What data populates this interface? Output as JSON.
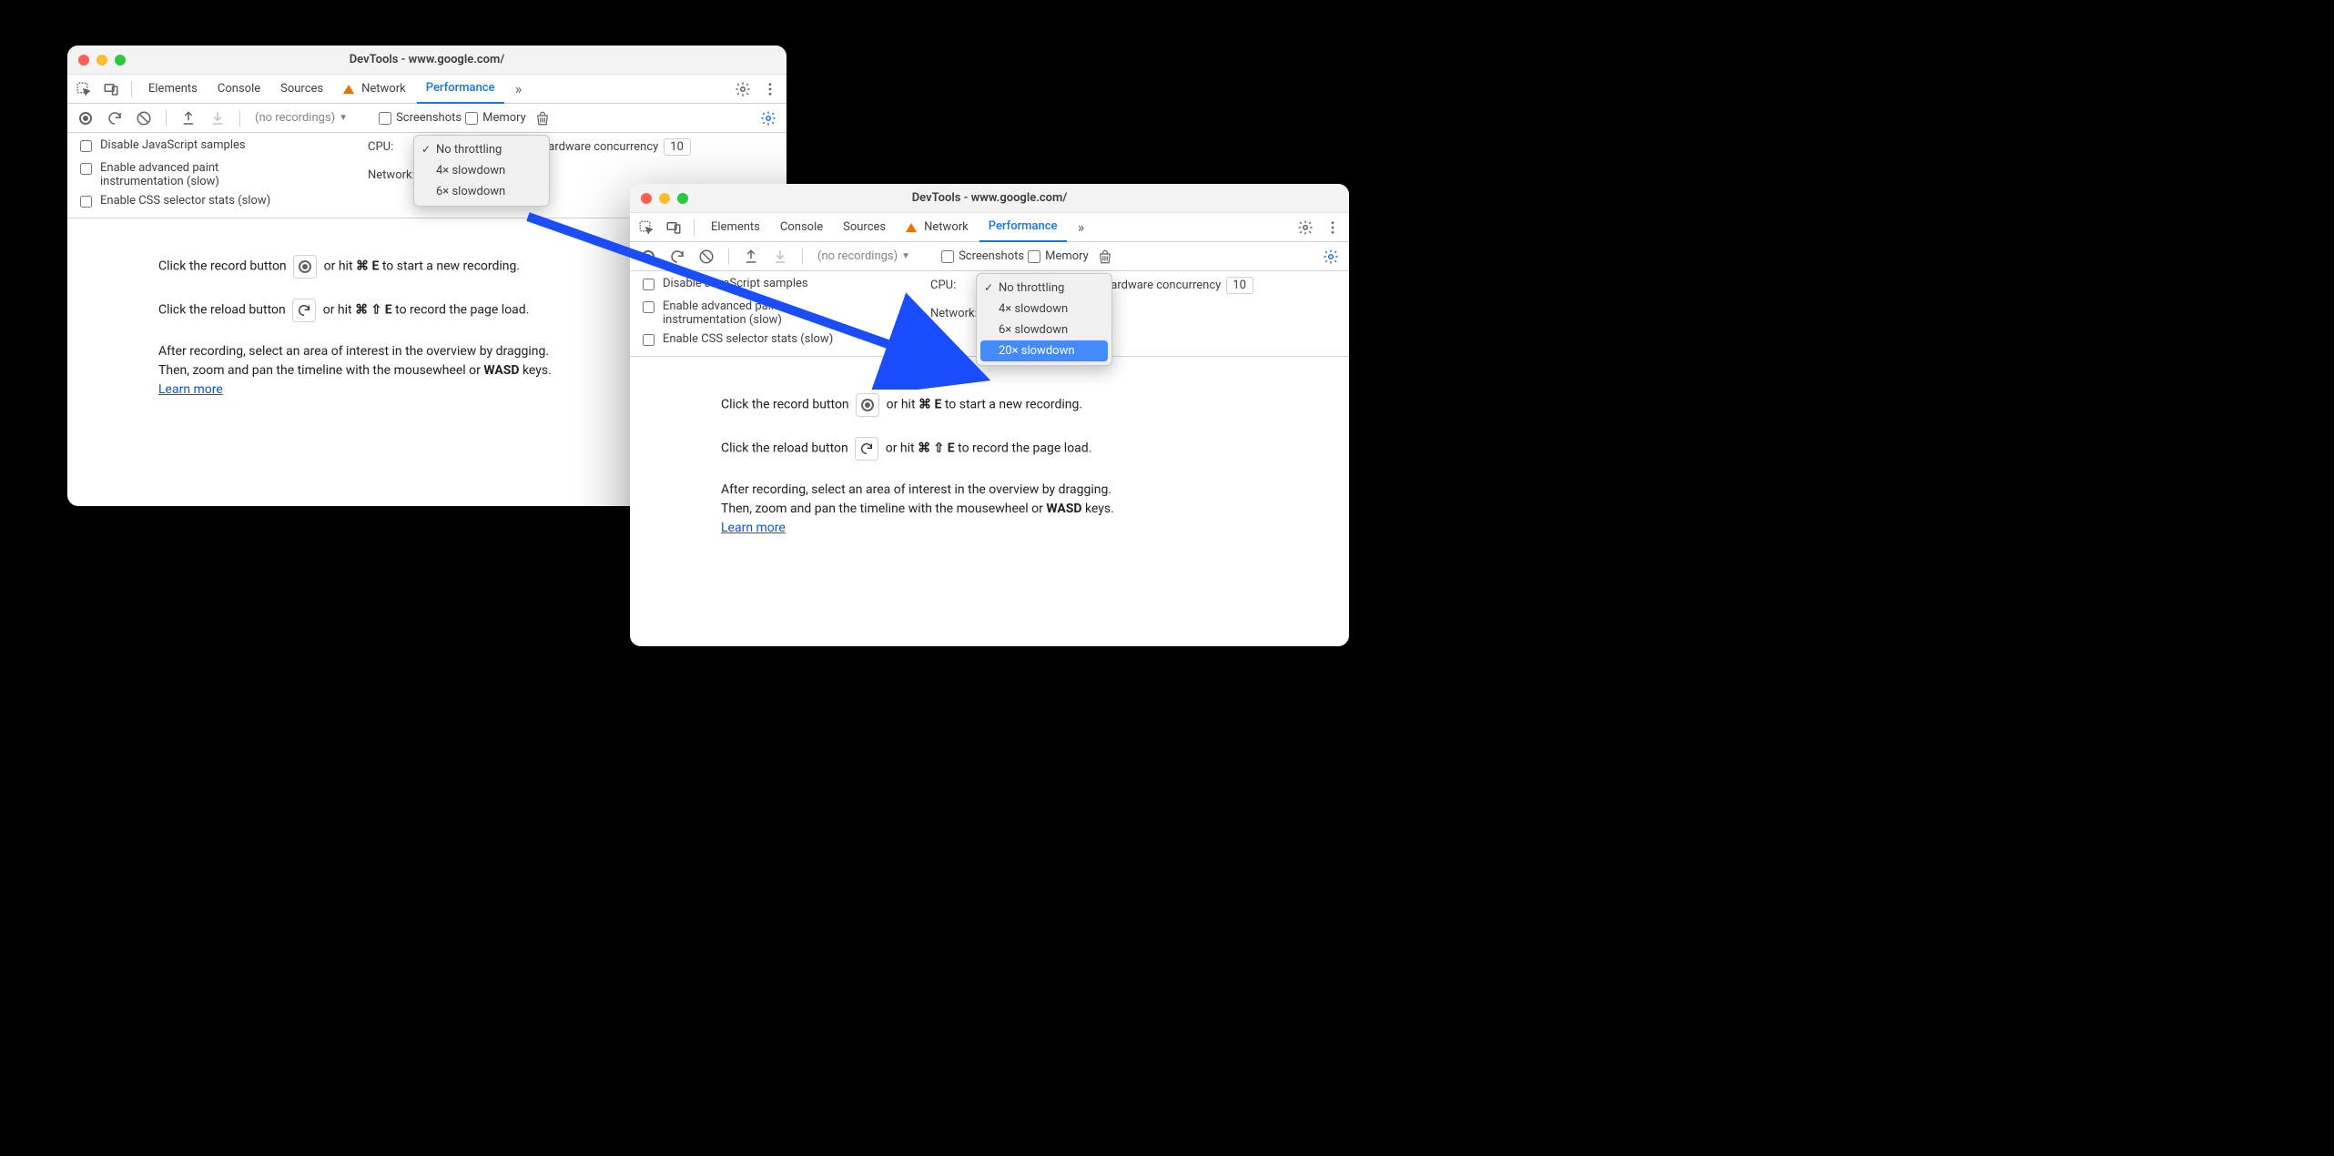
{
  "window_title": "DevTools - www.google.com/",
  "tabs": {
    "elements": "Elements",
    "console": "Console",
    "sources": "Sources",
    "network": "Network",
    "performance": "Performance"
  },
  "perf_toolbar": {
    "no_recordings": "(no recordings)",
    "screenshots": "Screenshots",
    "memory": "Memory"
  },
  "settings": {
    "disable_js": "Disable JavaScript samples",
    "adv_paint": "Enable advanced paint instrumentation (slow)",
    "css_stats": "Enable CSS selector stats (slow)",
    "cpu_label": "CPU:",
    "network_label": "Network:",
    "hw_concurrency": "Hardware concurrency",
    "hw_value": "10"
  },
  "dropdown_a": {
    "items": [
      "No throttling",
      "4× slowdown",
      "6× slowdown"
    ],
    "checked_index": 0
  },
  "dropdown_b": {
    "items": [
      "No throttling",
      "4× slowdown",
      "6× slowdown",
      "20× slowdown"
    ],
    "checked_index": 0,
    "highlight_index": 3
  },
  "help": {
    "record_pre": "Click the record button ",
    "record_post_pre": " or hit ",
    "record_key": "⌘ E",
    "record_post": " to start a new recording.",
    "reload_pre": "Click the reload button ",
    "reload_key": "⌘ ⇧ E",
    "reload_post": " to record the page load.",
    "after1": "After recording, select an area of interest in the overview by dragging.",
    "after2_pre": "Then, zoom and pan the timeline with the mousewheel or ",
    "after2_bold": "WASD",
    "after2_post": " keys.",
    "learn": "Learn more"
  }
}
